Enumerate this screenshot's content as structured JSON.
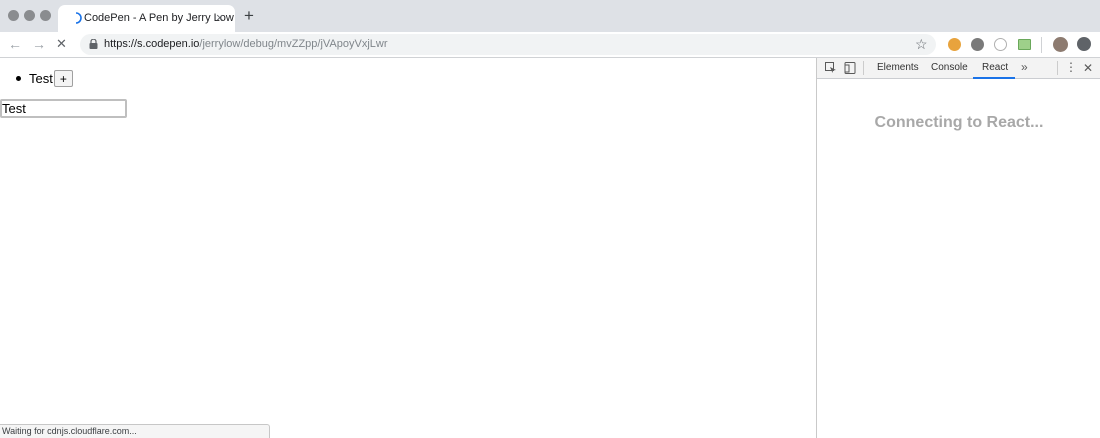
{
  "browser": {
    "tab_title": "CodePen - A Pen by Jerry Low",
    "tab_close": "×",
    "new_tab": "+",
    "url_host": "https://s.codepen.io",
    "url_path": "/jerrylow/debug/mvZZpp/jVApoyVxjLwr",
    "back": "←",
    "forward": "→",
    "stop": "✕",
    "bookmark": "☆"
  },
  "page": {
    "list_item": "Test",
    "add_button": "+",
    "input_value": "Test",
    "status": "Waiting for cdnjs.cloudflare.com..."
  },
  "devtools": {
    "tabs": [
      "Elements",
      "Console",
      "React"
    ],
    "active_tab": "React",
    "more": "»",
    "kebab": "⋮",
    "close": "✕",
    "message": "Connecting to React..."
  },
  "colors": {
    "tabstrip": "#dee1e6",
    "accent": "#1a73e8",
    "muted_text": "#a8a8a8"
  }
}
